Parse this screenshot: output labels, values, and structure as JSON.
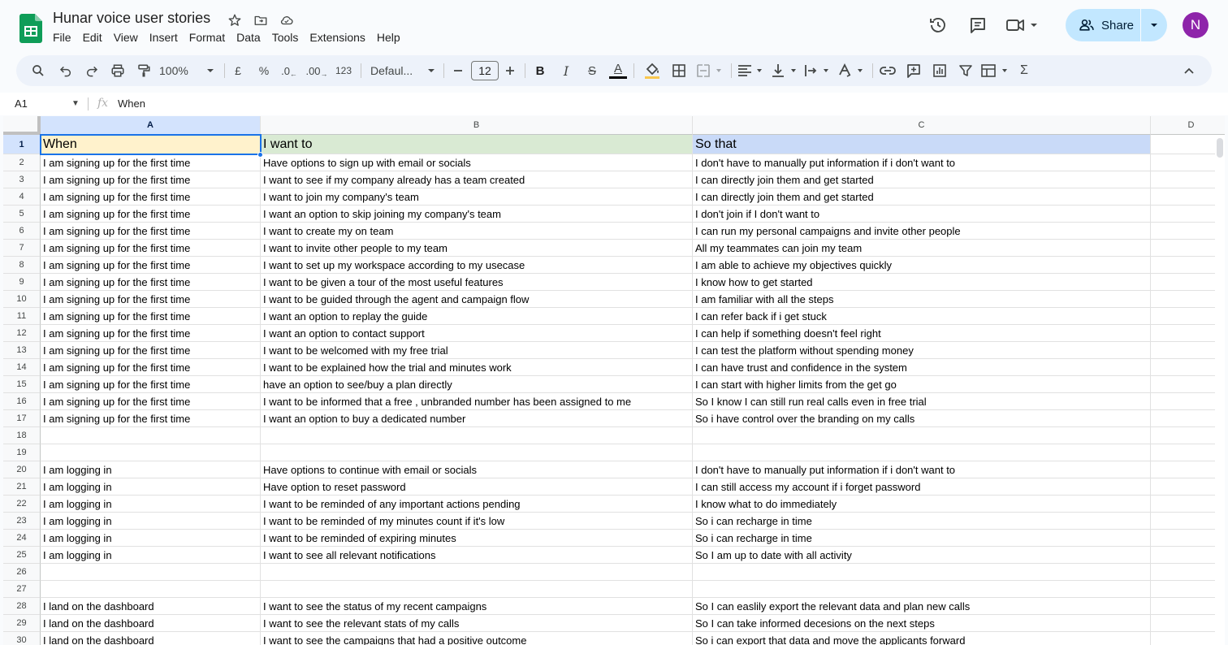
{
  "app": {
    "title": "Hunar voice user stories",
    "menu": [
      "File",
      "Edit",
      "View",
      "Insert",
      "Format",
      "Data",
      "Tools",
      "Extensions",
      "Help"
    ],
    "share_label": "Share",
    "avatar_initial": "N",
    "accent": "#1a73e8",
    "share_bg": "#c2e7ff",
    "avatar_color": "#8e24aa"
  },
  "toolbar": {
    "zoom": "100%",
    "currency": "£",
    "percent": "%",
    "dec_decrease": ".0",
    "dec_increase": ".00",
    "number_format": "123",
    "font": "Defaul...",
    "font_size": "12",
    "bold": "B",
    "italic": "I",
    "strike": "S",
    "text_color": "A",
    "sum": "Σ"
  },
  "formula_bar": {
    "name_box": "A1",
    "fx": "fx",
    "content": "When"
  },
  "grid": {
    "columns": [
      "A",
      "B",
      "C",
      "D"
    ],
    "rows": [
      {
        "n": "1",
        "a": "When",
        "b": "I want to",
        "c": "So that"
      },
      {
        "n": "2",
        "a": "I am signing up for the first time",
        "b": "Have options to sign up with email or socials",
        "c": "I don't have to manually put information if i don't want to"
      },
      {
        "n": "3",
        "a": "I am signing up for the first time",
        "b": "I want to see if my company already has a team created",
        "c": "I can directly join them and get started"
      },
      {
        "n": "4",
        "a": "I am signing up for the first time",
        "b": "I want to join my company's team",
        "c": "I can directly join them and get started"
      },
      {
        "n": "5",
        "a": "I am signing up for the first time",
        "b": "I want an option to skip joining my company's team",
        "c": "I don't join if I don't want to"
      },
      {
        "n": "6",
        "a": "I am signing up for the first time",
        "b": "I want to create my on team",
        "c": "I can run my personal campaigns and invite other people"
      },
      {
        "n": "7",
        "a": "I am signing up for the first time",
        "b": "I want to invite other people to my team",
        "c": "All my teammates can join my team"
      },
      {
        "n": "8",
        "a": "I am signing up for the first time",
        "b": "I want to set up my workspace according to my usecase",
        "c": "I am able to achieve my objectives quickly"
      },
      {
        "n": "9",
        "a": "I am signing up for the first time",
        "b": "I want to be given a tour of the most useful features",
        "c": "I know how to get started"
      },
      {
        "n": "10",
        "a": "I am signing up for the first time",
        "b": "I want to be guided through the agent and campaign flow",
        "c": "I am familiar with all the steps"
      },
      {
        "n": "11",
        "a": "I am signing up for the first time",
        "b": "I want an option to replay the guide",
        "c": "I can refer back if i get stuck"
      },
      {
        "n": "12",
        "a": "I am signing up for the first time",
        "b": "I want an option to contact support",
        "c": "I can help if something doesn't feel right"
      },
      {
        "n": "13",
        "a": "I am signing up for the first time",
        "b": "I want to be welcomed with my free trial",
        "c": "I can test the platform without spending money"
      },
      {
        "n": "14",
        "a": "I am signing up for the first time",
        "b": "I want to be explained how the trial and minutes work",
        "c": "I can have trust and confidence in the system"
      },
      {
        "n": "15",
        "a": "I am signing up for the first time",
        "b": "have an option to see/buy a plan directly",
        "c": "I can start with higher limits from the get go"
      },
      {
        "n": "16",
        "a": "I am signing up for the first time",
        "b": "I want to be informed that a free , unbranded number has been assigned to me",
        "c": "So I know I can still run real calls even in free trial"
      },
      {
        "n": "17",
        "a": "I am signing up for the first time",
        "b": "I want an option to buy a dedicated number",
        "c": "So i have control over the branding on my calls"
      },
      {
        "n": "18",
        "a": "",
        "b": "",
        "c": ""
      },
      {
        "n": "19",
        "a": "",
        "b": "",
        "c": ""
      },
      {
        "n": "20",
        "a": "I am logging in",
        "b": "Have options to continue with email or socials",
        "c": "I don't have to manually put information if i don't want to"
      },
      {
        "n": "21",
        "a": "I am logging in",
        "b": "Have option to reset password",
        "c": "I can still access my account if i forget password"
      },
      {
        "n": "22",
        "a": "I am logging in",
        "b": "I want to be reminded of any important actions pending",
        "c": "I know what to do immediately"
      },
      {
        "n": "23",
        "a": "I am logging in",
        "b": "I want to be reminded of my minutes count if it's low",
        "c": "So i can recharge in time"
      },
      {
        "n": "24",
        "a": "I am logging in",
        "b": "I want to be reminded of expiring minutes",
        "c": "So i can recharge in time"
      },
      {
        "n": "25",
        "a": "I am logging in",
        "b": "I want to see all relevant notifications",
        "c": "So I am up to date with all activity"
      },
      {
        "n": "26",
        "a": "",
        "b": "",
        "c": ""
      },
      {
        "n": "27",
        "a": "",
        "b": "",
        "c": ""
      },
      {
        "n": "28",
        "a": "I land on the dashboard",
        "b": "I want to see the status of my recent campaigns",
        "c": "So I can easlily export the relevant data and plan new calls"
      },
      {
        "n": "29",
        "a": "I land on the dashboard",
        "b": "I want to see the relevant stats of my calls",
        "c": "So I can take informed decesions on the next steps"
      },
      {
        "n": "30",
        "a": "I land on the dashboard",
        "b": "I want to see the campaigns that had a positive outcome",
        "c": "So i can export that data and move the applicants forward"
      }
    ],
    "header_colors": {
      "a": "#fff2cc",
      "b": "#d9ead3",
      "c": "#c9daf8"
    }
  }
}
